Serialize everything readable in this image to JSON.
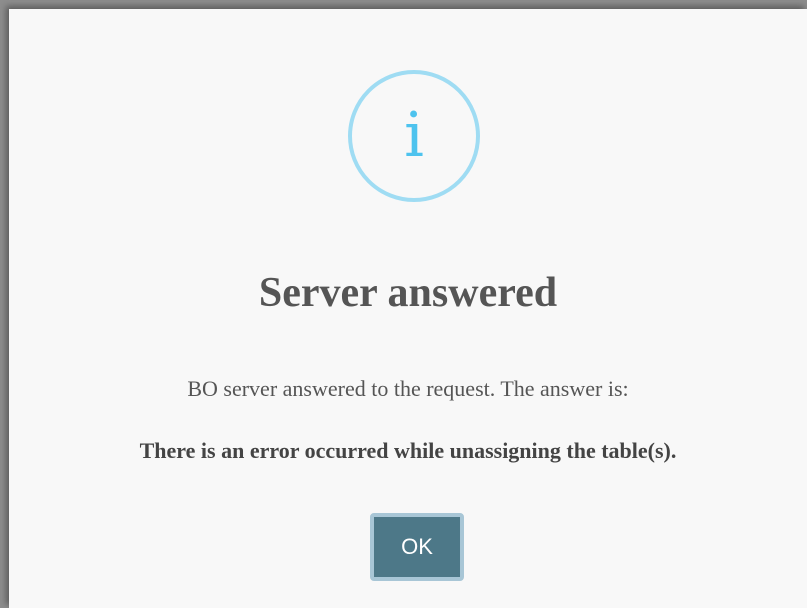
{
  "dialog": {
    "icon": "info-icon",
    "icon_glyph": "i",
    "title": "Server answered",
    "message": "BO server answered to the request. The answer is:",
    "error_text": "There is an error occurred while unassigning the table(s).",
    "ok_label": "OK"
  },
  "colors": {
    "icon_ring": "#9fdcf3",
    "icon_glyph": "#4ec3ee",
    "button_bg": "#4d7888",
    "button_border": "#a8c6d6",
    "text": "#555555"
  }
}
